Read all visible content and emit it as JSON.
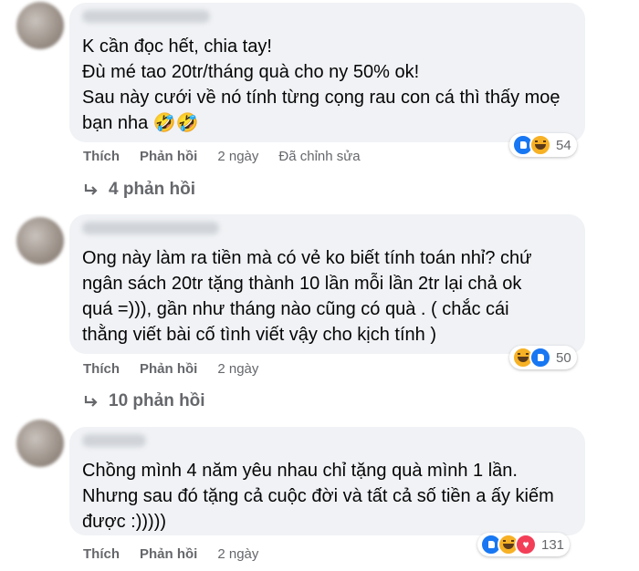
{
  "comments": [
    {
      "text": "K cần đọc hết, chia tay!\nĐù mé tao 20tr/tháng quà cho ny 50% ok!\nSau này cưới về nó tính từng cọng rau con cá thì thấy moẹ bạn nha 🤣🤣",
      "reactions": [
        "like",
        "haha"
      ],
      "reaction_count": "54",
      "like_label": "Thích",
      "reply_label": "Phản hồi",
      "time": "2 ngày",
      "edited": "Đã chỉnh sửa",
      "replies_label": "4 phản hồi"
    },
    {
      "text": "Ong này làm ra tiền mà có vẻ ko biết tính toán nhỉ? chứ ngân sách 20tr tặng thành 10 lần mỗi lần 2tr lại chả ok quá =))), gần như tháng nào cũng có quà . ( chắc cái thằng viết bài cố tình viết vậy cho kịch tính )",
      "reactions": [
        "haha",
        "like"
      ],
      "reaction_count": "50",
      "like_label": "Thích",
      "reply_label": "Phản hồi",
      "time": "2 ngày",
      "replies_label": "10 phản hồi"
    },
    {
      "text": "Chồng mình 4 năm yêu nhau chỉ tặng quà mình 1 lần.\nNhưng sau đó tặng cả cuộc đời và tất cả số tiền a ấy kiếm được :)))))",
      "reactions": [
        "like",
        "haha",
        "love"
      ],
      "reaction_count": "131",
      "like_label": "Thích",
      "reply_label": "Phản hồi",
      "time": "2 ngày"
    }
  ]
}
